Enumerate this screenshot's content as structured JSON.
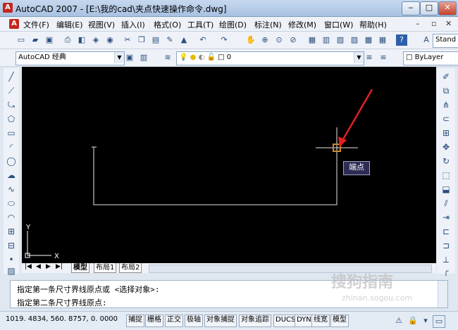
{
  "window": {
    "title": "AutoCAD 2007 - [E:\\我的cad\\夹点快速操作命令.dwg]"
  },
  "menu": {
    "items": [
      "文件(F)",
      "编辑(E)",
      "视图(V)",
      "插入(I)",
      "格式(O)",
      "工具(T)",
      "绘图(D)",
      "标注(N)",
      "修改(M)",
      "窗口(W)",
      "帮助(H)"
    ]
  },
  "toolbar": {
    "workspace": "AutoCAD 经典",
    "layer_value": "0",
    "bylayer": "ByLayer",
    "style_value": "Stand"
  },
  "canvas": {
    "tooltip": "端点",
    "ucs_x": "X",
    "ucs_y": "Y"
  },
  "layout_tabs": [
    "模型",
    "布局1",
    "布局2"
  ],
  "command": {
    "line1": "指定第一条尺寸界线原点或 <选择对象>:",
    "line2": "指定第二条尺寸界线原点:"
  },
  "status": {
    "coords": "1019. 4834,  560. 8757,  0. 0000",
    "buttons": [
      "捕捉",
      "栅格",
      "正交",
      "极轴",
      "对象捕捉",
      "对象追踪",
      "DUCS",
      "DYN",
      "线宽",
      "模型"
    ]
  },
  "watermark": {
    "brand": "搜狗指南",
    "url": "zhinan.sogou.com"
  },
  "colors": {
    "canvas": "#000000",
    "geometry": "#ffffff",
    "arrow": "#e02020",
    "titlebar": "#b3c9e6"
  }
}
